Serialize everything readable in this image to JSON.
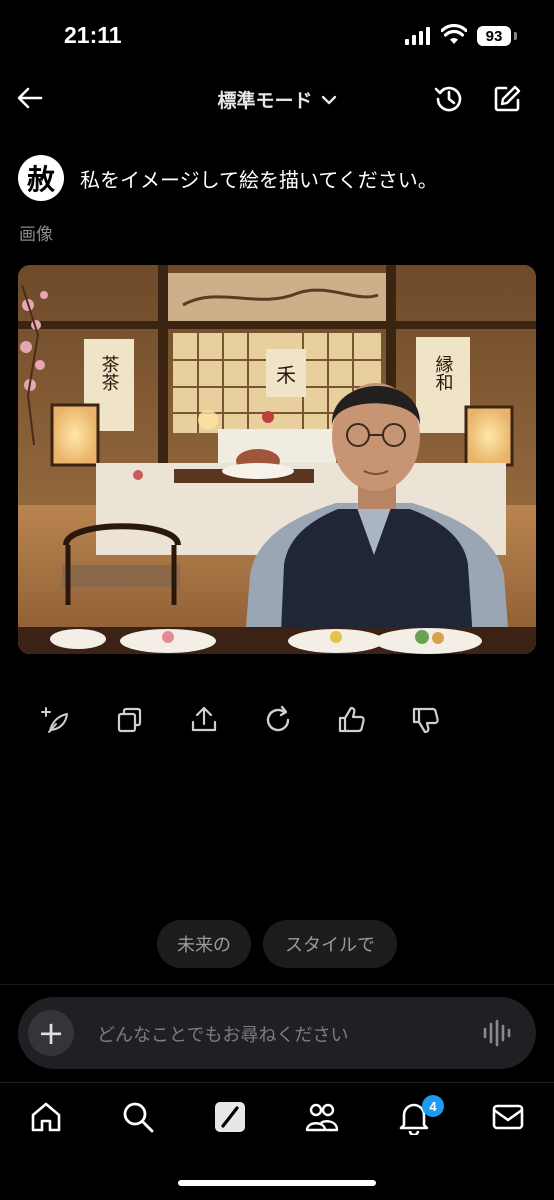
{
  "status_bar": {
    "time": "21:11",
    "battery": "93"
  },
  "header": {
    "mode_label": "標準モード"
  },
  "message": {
    "avatar_glyph": "赦",
    "prompt": "私をイメージして絵を描いてください。",
    "result_label": "画像"
  },
  "image": {
    "description_hidden": "",
    "scroll_left_text": "茶茶",
    "scroll_center_text": "禾",
    "scroll_right_text": "縁和"
  },
  "suggestions": [
    "未来の",
    "スタイルで"
  ],
  "composer": {
    "placeholder": "どんなことでもお尋ねください"
  },
  "nav": {
    "notification_count": "4"
  }
}
